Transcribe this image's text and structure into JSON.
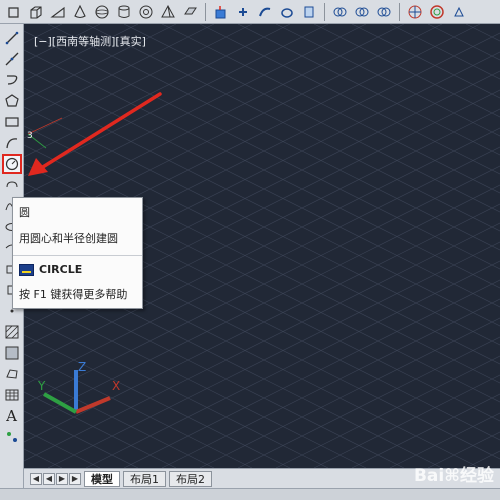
{
  "viewport": {
    "label": "[−][西南等轴测][真实]",
    "background": "#212836",
    "grid_color": "#3a4254",
    "axis_colors": {
      "x": "#c0392b",
      "y": "#2ea043",
      "z": "#3a7bd5"
    }
  },
  "tooltip": {
    "title": "圆",
    "description": "用圆心和半径创建圆",
    "command": "CIRCLE",
    "help": "按 F1 键获得更多帮助"
  },
  "ucs": {
    "x_label": "X",
    "y_label": "Y",
    "z_label": "Z"
  },
  "left_toolbar": {
    "text_tool_label": "A",
    "tools": [
      "line-icon",
      "construction-line-icon",
      "polyline-icon",
      "polygon-icon",
      "rectangle-icon",
      "arc-icon",
      "circle-icon"
    ],
    "active_tool": "circle-icon"
  },
  "tabs": {
    "items": [
      "模型",
      "布局1",
      "布局2"
    ],
    "active": "模型"
  },
  "annotation": {
    "color": "#e0281f"
  },
  "watermark": {
    "text": "Bai⌘经验"
  }
}
